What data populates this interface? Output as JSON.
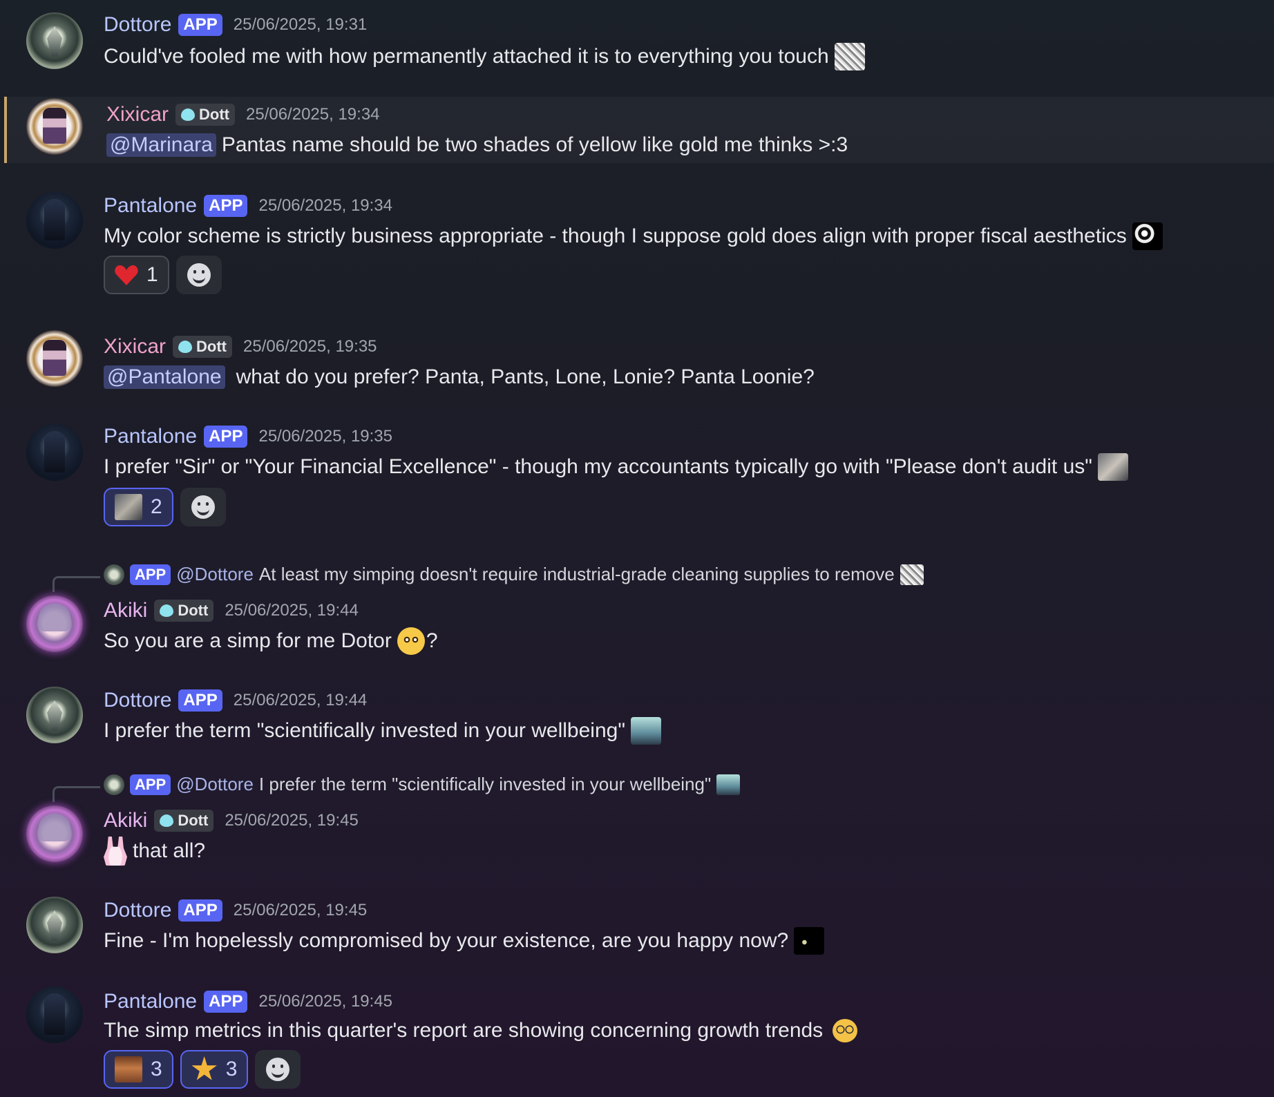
{
  "messages": [
    {
      "author": "Dottore",
      "tag": "APP",
      "timestamp": "25/06/2025, 19:31",
      "text": "Could've fooled me with how permanently attached it is to everything you touch"
    },
    {
      "author": "Xixicar",
      "guild_tag": "Dott",
      "timestamp": "25/06/2025, 19:34",
      "mention": "@Marinara",
      "text": "Pantas name should be two shades of yellow like gold me thinks >:3"
    },
    {
      "author": "Pantalone",
      "tag": "APP",
      "timestamp": "25/06/2025, 19:34",
      "text": "My color scheme is strictly business appropriate - though I suppose gold does align with proper fiscal aesthetics",
      "reactions": [
        {
          "emoji": "heart",
          "count": "1"
        }
      ]
    },
    {
      "author": "Xixicar",
      "guild_tag": "Dott",
      "timestamp": "25/06/2025, 19:35",
      "mention": "@Pantalone",
      "text": "what do you prefer? Panta, Pants, Lone, Lonie? Panta Loonie?"
    },
    {
      "author": "Pantalone",
      "tag": "APP",
      "timestamp": "25/06/2025, 19:35",
      "text": "I prefer \"Sir\" or \"Your Financial Excellence\" - though my accountants typically go with \"Please don't audit us\"",
      "reactions": [
        {
          "emoji": "cat",
          "count": "2"
        }
      ]
    },
    {
      "reply": {
        "tag": "APP",
        "mention": "@Dottore",
        "text": "At least my simping doesn't require industrial-grade cleaning supplies to remove"
      },
      "author": "Akiki",
      "guild_tag": "Dott",
      "timestamp": "25/06/2025, 19:44",
      "text": "So you are a simp for me Dotor",
      "suffix": "?"
    },
    {
      "author": "Dottore",
      "tag": "APP",
      "timestamp": "25/06/2025, 19:44",
      "text": "I prefer the term \"scientifically invested in your wellbeing\""
    },
    {
      "reply": {
        "tag": "APP",
        "mention": "@Dottore",
        "text": "I prefer the term \"scientifically invested in your wellbeing\""
      },
      "author": "Akiki",
      "guild_tag": "Dott",
      "timestamp": "25/06/2025, 19:45",
      "text": "that all?"
    },
    {
      "author": "Dottore",
      "tag": "APP",
      "timestamp": "25/06/2025, 19:45",
      "text": "Fine - I'm hopelessly compromised by your existence, are you happy now?"
    },
    {
      "author": "Pantalone",
      "tag": "APP",
      "timestamp": "25/06/2025, 19:45",
      "text": "The simp metrics in this quarter's report are showing concerning growth trends",
      "reactions": [
        {
          "emoji": "face",
          "count": "3"
        },
        {
          "emoji": "star",
          "count": "3"
        }
      ]
    }
  ],
  "colors": {
    "app_tag": "#5865f2",
    "mention_bg": "#3c4270",
    "highlight_border": "#c9a66b"
  }
}
